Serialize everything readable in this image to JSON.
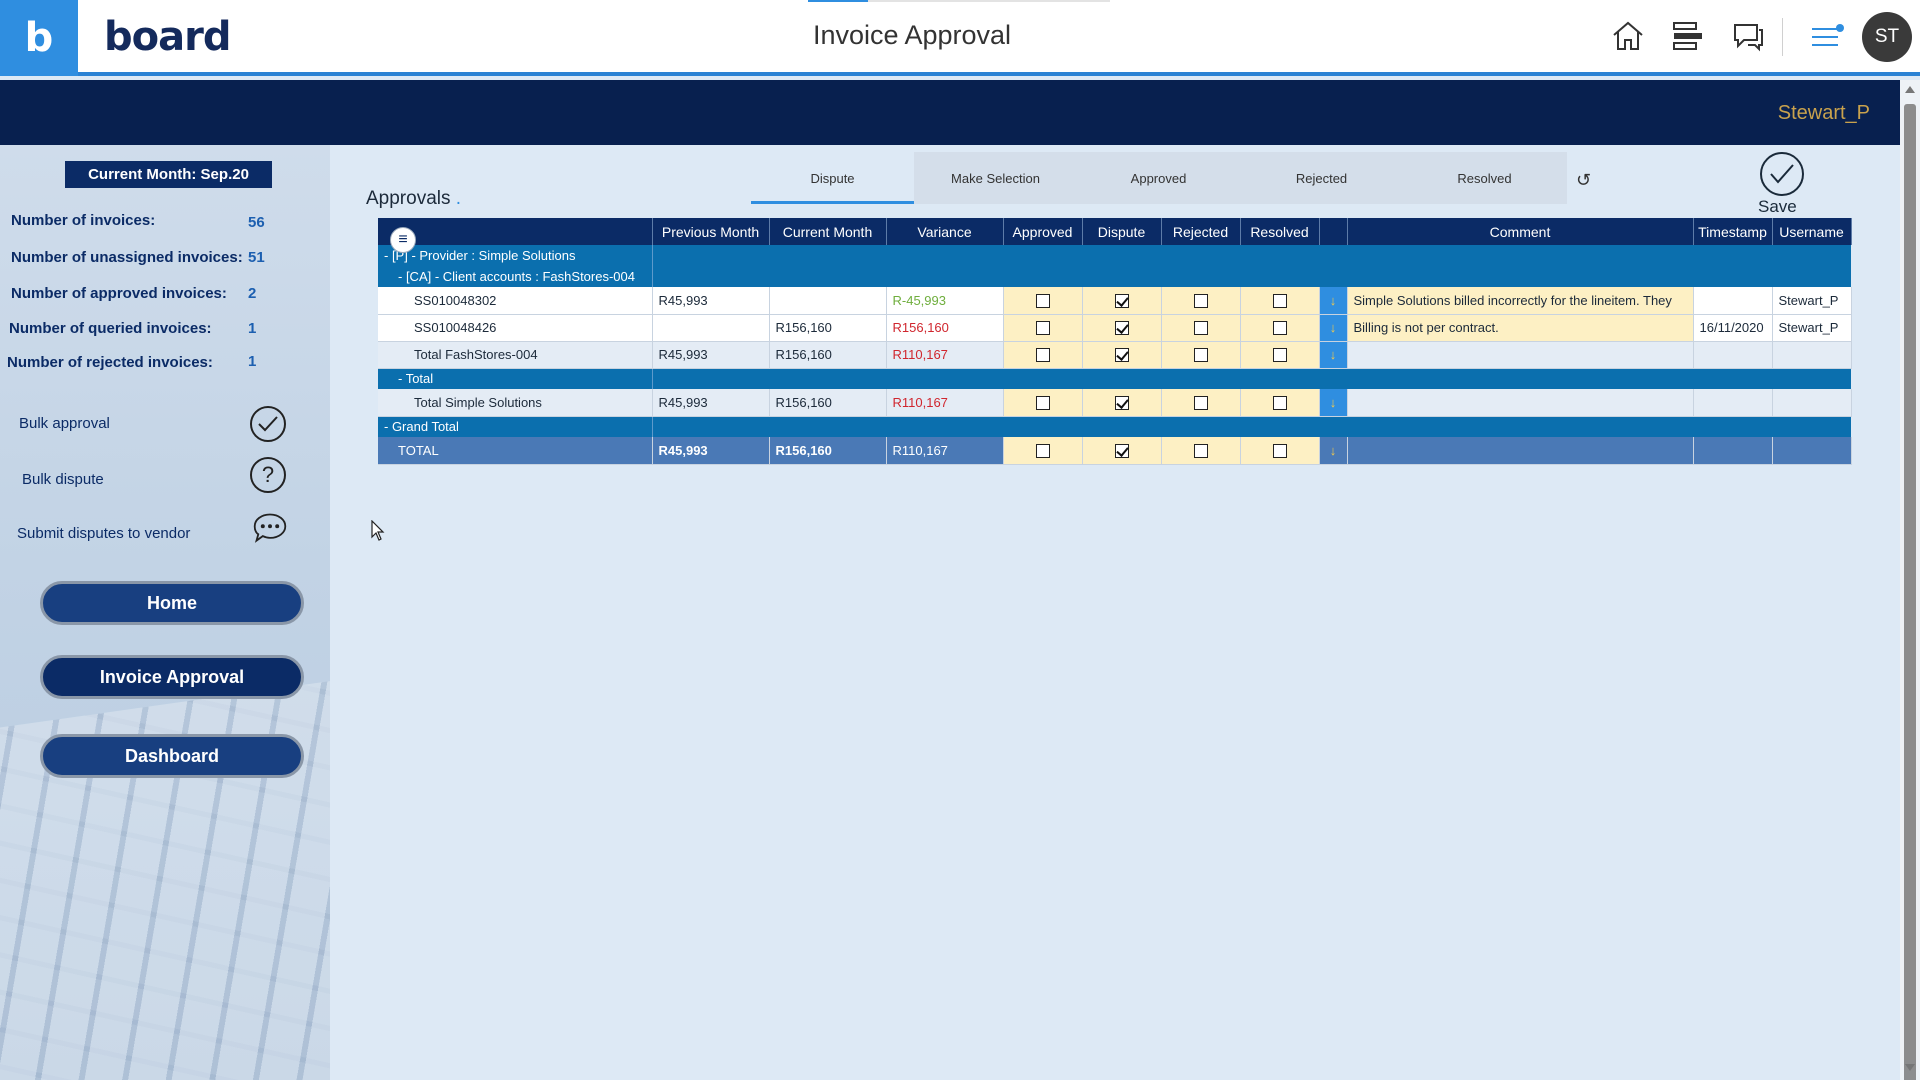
{
  "app": {
    "brand_tile": "b",
    "brand_word": "board",
    "title": "Invoice Approval",
    "avatar": "ST",
    "user": "Stewart_P"
  },
  "sidebar": {
    "current_month": "Current Month: Sep.20",
    "stats": [
      {
        "label": "Number of invoices:",
        "value": "56"
      },
      {
        "label": "Number of unassigned invoices:",
        "value": "51"
      },
      {
        "label": "Number of approved invoices:",
        "value": "2"
      },
      {
        "label": "Number of queried invoices:",
        "value": "1"
      },
      {
        "label": "Number of rejected invoices:",
        "value": "1"
      }
    ],
    "actions": [
      {
        "label": "Bulk approval",
        "icon": "check-circle-icon"
      },
      {
        "label": "Bulk dispute",
        "icon": "question-circle-icon"
      },
      {
        "label": "Submit disputes to vendor",
        "icon": "chat-bubble-icon"
      }
    ],
    "nav": [
      "Home",
      "Invoice Approval",
      "Dashboard"
    ]
  },
  "main": {
    "title": "Approvals",
    "title_dot": ".",
    "tabs": [
      "Dispute",
      "Make Selection",
      "Approved",
      "Rejected",
      "Resolved"
    ],
    "save_label": "Save"
  },
  "table": {
    "headers": [
      "Previous Month",
      "Current Month",
      "Variance",
      "Approved",
      "Dispute",
      "Rejected",
      "Resolved",
      "",
      "Comment",
      "Timestamp",
      "Username"
    ],
    "group_provider": "-  [P] - Provider : Simple Solutions",
    "group_client": "-  [CA] - Client accounts : FashStores-004",
    "group_total": "-  Total",
    "group_grand": "-  Grand Total",
    "rows": [
      {
        "name": "SS010048302",
        "prev": "R45,993",
        "curr": "",
        "var": "R-45,993",
        "var_color": "green",
        "approved": false,
        "dispute": true,
        "rejected": false,
        "resolved": false,
        "comment": "Simple Solutions billed incorrectly for the lineitem. They",
        "timestamp": "",
        "username": "Stewart_P"
      },
      {
        "name": "SS010048426",
        "prev": "",
        "curr": "R156,160",
        "var": "R156,160",
        "var_color": "red",
        "approved": false,
        "dispute": true,
        "rejected": false,
        "resolved": false,
        "comment": "Billing is not per contract.",
        "timestamp": "16/11/2020",
        "username": "Stewart_P"
      }
    ],
    "subtotal_fash": {
      "name": "Total FashStores-004",
      "prev": "R45,993",
      "curr": "R156,160",
      "var": "R110,167"
    },
    "subtotal_simple": {
      "name": "Total Simple Solutions",
      "prev": "R45,993",
      "curr": "R156,160",
      "var": "R110,167"
    },
    "grand_total": {
      "name": "TOTAL",
      "prev": "R45,993",
      "curr": "R156,160",
      "var": "R110,167"
    }
  },
  "colors": {
    "accent": "#2f8ee0",
    "navy": "#0b2b66",
    "band": "#08204f",
    "group": "#0b6fae",
    "checkbox_cell": "#fdf0c4",
    "variance_red": "#d0262e",
    "variance_green": "#6fae3d"
  }
}
